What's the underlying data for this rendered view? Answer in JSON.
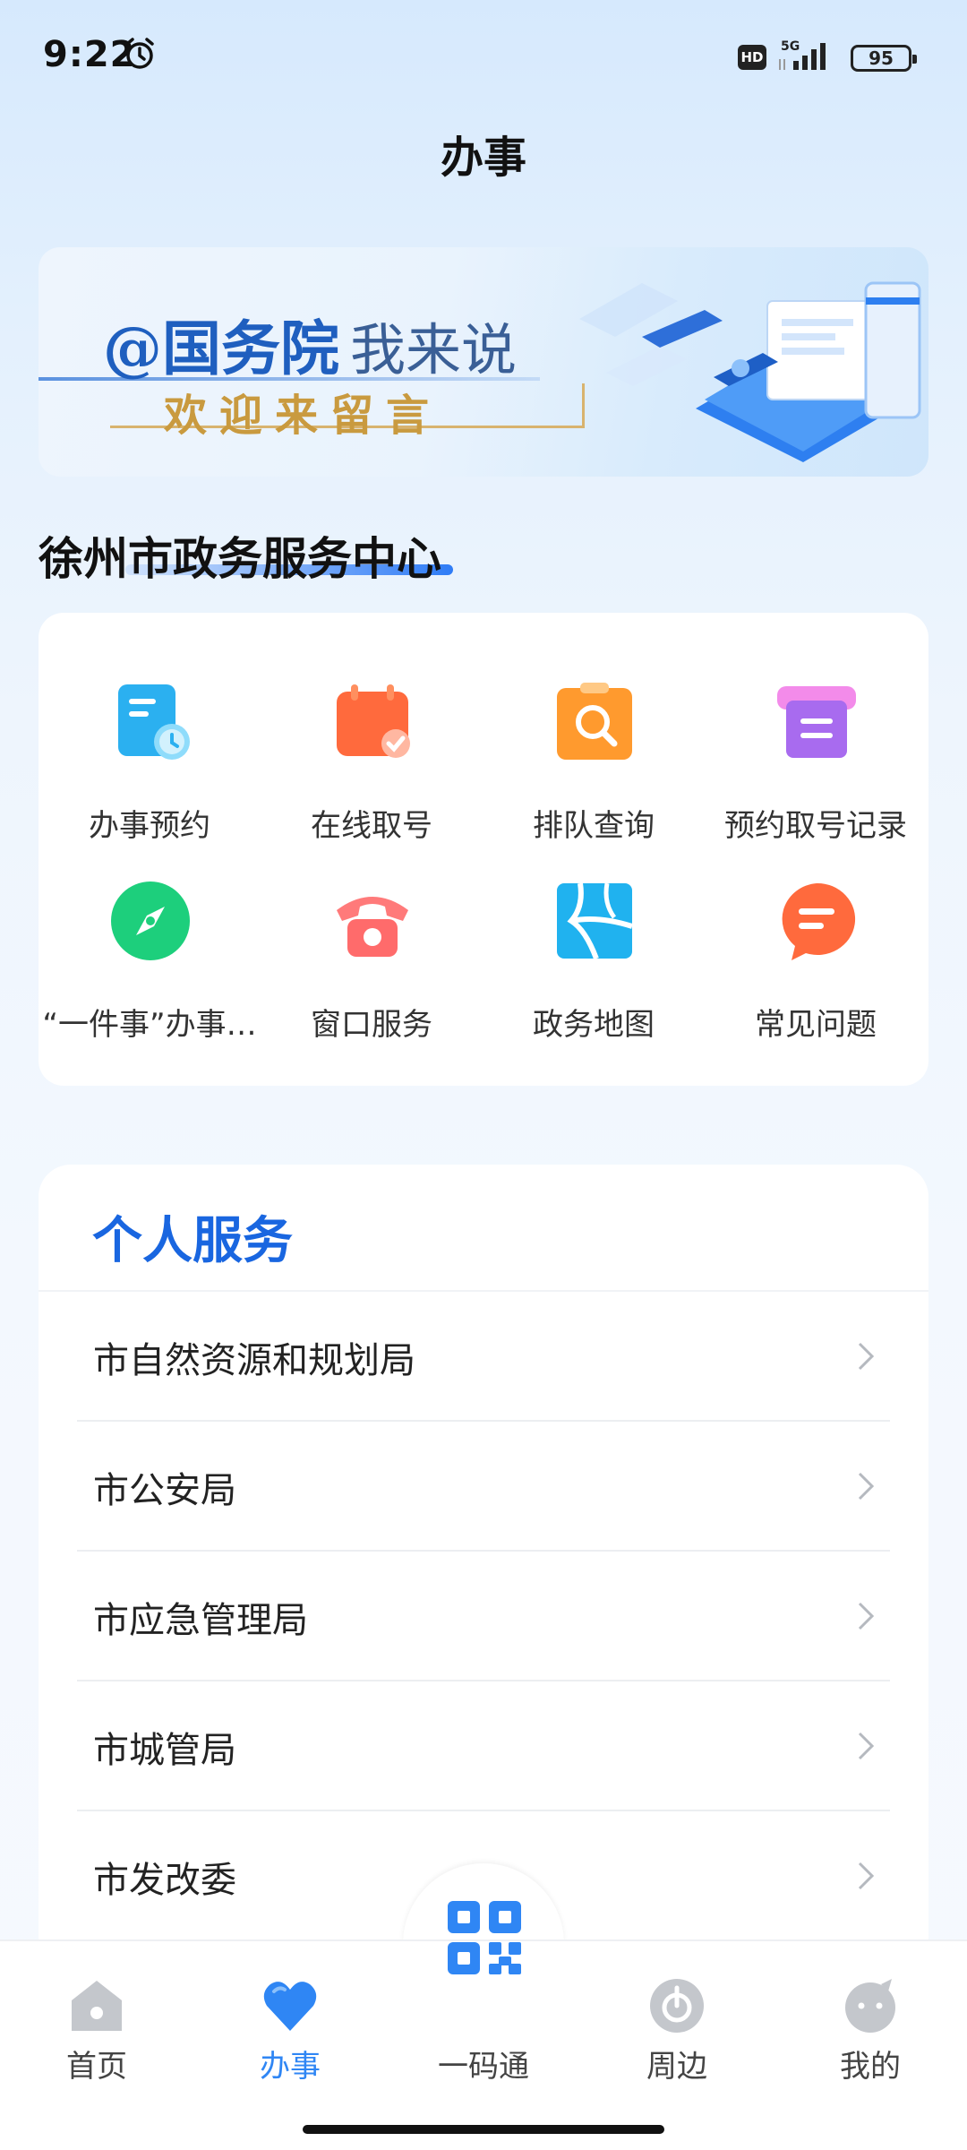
{
  "status_bar": {
    "time": "9:22",
    "hd": "HD",
    "network": "5G",
    "battery": "95"
  },
  "page_title": "办事",
  "banner": {
    "headline": "@国务院",
    "headline_sub": "我来说",
    "subtitle": "欢迎来留言"
  },
  "center": {
    "title": "徐州市政务服务中心",
    "items": [
      {
        "label": "办事预约",
        "icon": "appointment-icon"
      },
      {
        "label": "在线取号",
        "icon": "calendar-check-icon"
      },
      {
        "label": "排队查询",
        "icon": "queue-search-icon"
      },
      {
        "label": "预约取号记录",
        "icon": "ticket-record-icon"
      },
      {
        "label": "“一件事”办事…",
        "icon": "compass-icon"
      },
      {
        "label": "窗口服务",
        "icon": "telephone-icon"
      },
      {
        "label": "政务地图",
        "icon": "map-icon"
      },
      {
        "label": "常见问题",
        "icon": "chat-bubble-icon"
      }
    ]
  },
  "personal": {
    "title": "个人服务",
    "rows": [
      {
        "label": "市自然资源和规划局"
      },
      {
        "label": "市公安局"
      },
      {
        "label": "市应急管理局"
      },
      {
        "label": "市城管局"
      },
      {
        "label": "市发改委"
      }
    ]
  },
  "tabs": [
    {
      "label": "首页",
      "icon": "home-icon",
      "active": false
    },
    {
      "label": "办事",
      "icon": "heart-icon",
      "active": true
    },
    {
      "label": "一码通",
      "icon": "qr-code-icon",
      "active": false
    },
    {
      "label": "周边",
      "icon": "location-icon",
      "active": false
    },
    {
      "label": "我的",
      "icon": "profile-icon",
      "active": false
    }
  ],
  "colors": {
    "accent": "#2f86f4",
    "title_blue": "#1966e0"
  }
}
